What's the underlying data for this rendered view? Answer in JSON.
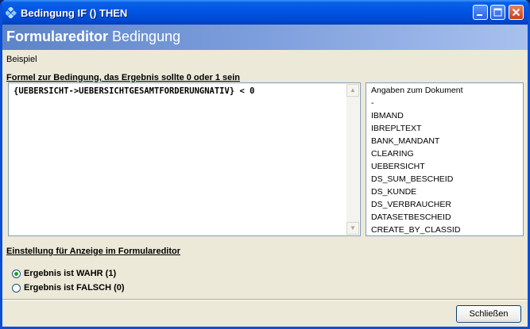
{
  "window": {
    "title": "Bedingung IF () THEN"
  },
  "header": {
    "title_bold": "Formulareditor",
    "title_rest": " Bedingung"
  },
  "example_label": "Beispiel",
  "formula": {
    "heading": "Formel zur Bedingung, das Ergebnis sollte 0 oder 1 sein",
    "text": "{UEBERSICHT->UEBERSICHTGESAMTFORDERUNGNATIV} < 0"
  },
  "field_list": {
    "items": [
      "Angaben zum Dokument",
      "-",
      "IBMAND",
      "IBREPLTEXT",
      "BANK_MANDANT",
      "CLEARING",
      "UEBERSICHT",
      "DS_SUM_BESCHEID",
      "DS_KUNDE",
      "DS_VERBRAUCHER",
      "DATASETBESCHEID",
      "CREATE_BY_CLASSID"
    ]
  },
  "display_setting": {
    "heading": "Einstellung für Anzeige im Formulareditor",
    "options": [
      {
        "label": "Ergebnis ist WAHR (1)",
        "checked": true
      },
      {
        "label": "Ergebnis ist FALSCH (0)",
        "checked": false
      }
    ]
  },
  "buttons": {
    "close": "Schließen"
  },
  "colors": {
    "title_bar": "#0055e5",
    "banner": "#7e9fdd",
    "radio_dot": "#21a121"
  }
}
